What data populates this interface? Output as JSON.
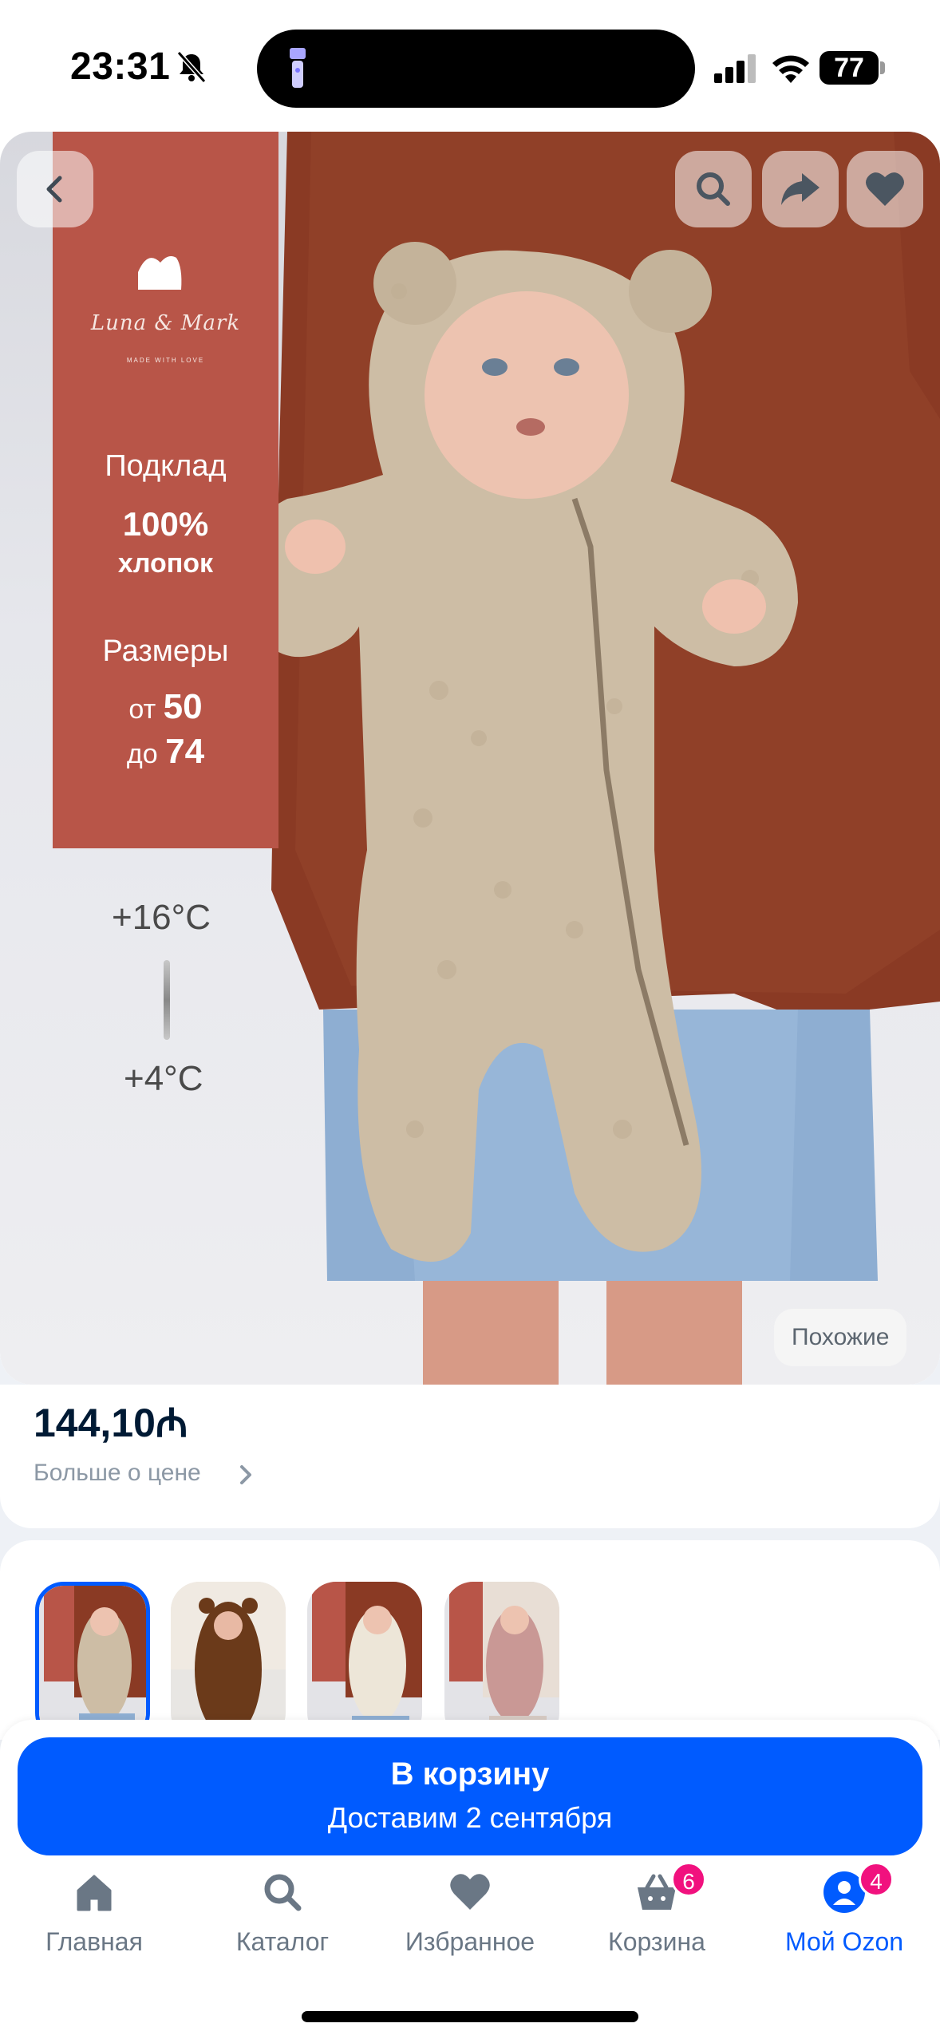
{
  "status_bar": {
    "time": "23:31",
    "battery": "77"
  },
  "promo": {
    "brand": "Luna & Mark",
    "tagline": "MADE WITH LOVE",
    "lining_title": "Подклад",
    "lining_percent": "100%",
    "lining_material": "хлопок",
    "sizes_title": "Размеры",
    "sizes_from_prefix": "от",
    "sizes_from": "50",
    "sizes_to_prefix": "до",
    "sizes_to": "74",
    "temp_high": "+16°C",
    "temp_low": "+4°C"
  },
  "similar_label": "Похожие",
  "price": {
    "value": "144,10₼",
    "more_label": "Больше о цене"
  },
  "thumbnails": [
    {
      "name": "thumb-beige-promo",
      "selected": true
    },
    {
      "name": "thumb-brown",
      "selected": false
    },
    {
      "name": "thumb-cream-promo",
      "selected": false
    },
    {
      "name": "thumb-pink-promo",
      "selected": false
    }
  ],
  "cart_button": {
    "title": "В корзину",
    "subtitle": "Доставим 2 сентября"
  },
  "bottom_nav": {
    "home": "Главная",
    "catalog": "Каталог",
    "favorites": "Избранное",
    "cart": "Корзина",
    "cart_badge": "6",
    "profile": "Мой Ozon",
    "profile_badge": "4"
  },
  "colors": {
    "accent": "#005bff",
    "badge": "#f1117e",
    "promo_panel": "#b85548"
  }
}
